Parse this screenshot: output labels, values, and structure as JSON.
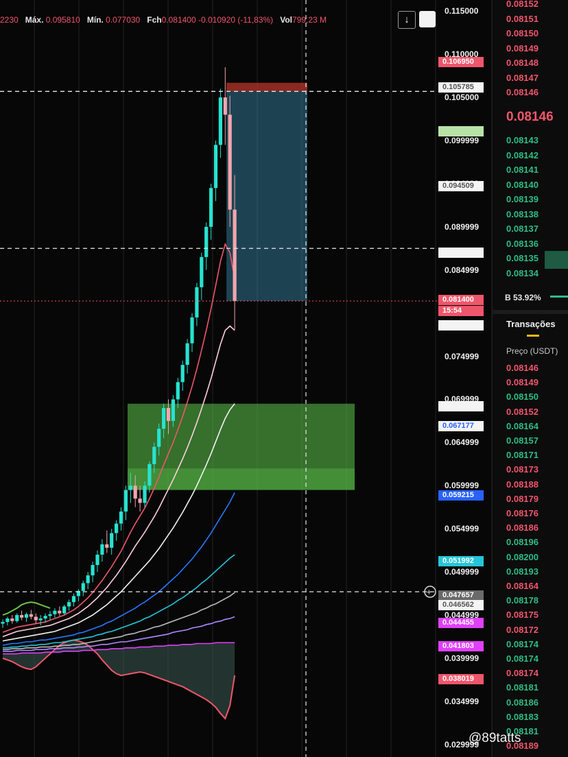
{
  "header": {
    "open_fragment": "2230",
    "high_label": "Máx.",
    "high_value": "0.095810",
    "low_label": "Mín.",
    "low_value": "0.077030",
    "close_label": "Fch",
    "close_value": "0.081400",
    "change": "-0.010920 (-11,83%)",
    "vol_label": "Vol",
    "vol_value": "799,23 M",
    "download_icon": "↓"
  },
  "price_axis": {
    "ticks": [
      "0.115000",
      "0.110000",
      "0.105000",
      "0.099999",
      "0.094999",
      "0.089999",
      "0.084999",
      "0.074999",
      "0.069999",
      "0.064999",
      "0.059999",
      "0.054999",
      "0.049999",
      "0.044999",
      "0.039999",
      "0.034999",
      "0.029999"
    ],
    "badges": [
      {
        "text": "0.106950",
        "bg": "#f0566b",
        "fg": "#ffffff"
      },
      {
        "text": "0.105785",
        "bg": "#f4f4f4",
        "fg": "#555555"
      },
      {
        "text": "",
        "bg": "#b8e3a7",
        "fg": "#222222"
      },
      {
        "text": "0.094509",
        "bg": "#f4f4f4",
        "fg": "#555555"
      },
      {
        "text": "",
        "bg": "#f4f4f4",
        "fg": "#333333"
      },
      {
        "text": "0.081400",
        "bg": "#f0566b",
        "fg": "#ffffff"
      },
      {
        "text": "15:54",
        "bg": "#f0566b",
        "fg": "#ffffff"
      },
      {
        "text": "",
        "bg": "#f4f4f4",
        "fg": "#333333"
      },
      {
        "text": "",
        "bg": "#f4f4f4",
        "fg": "#333333"
      },
      {
        "text": "0.067177",
        "bg": "#f4f4f4",
        "fg": "#2962ff"
      },
      {
        "text": "0.059215",
        "bg": "#2962ff",
        "fg": "#ffffff"
      },
      {
        "text": "0.051992",
        "bg": "#26c6da",
        "fg": "#ffffff"
      },
      {
        "text": "0.047657",
        "bg": "#6a6a6a",
        "fg": "#ffffff"
      },
      {
        "text": "0.046562",
        "bg": "#f4f4f4",
        "fg": "#555555"
      },
      {
        "text": "0.044455",
        "bg": "#e040fb",
        "fg": "#ffffff"
      },
      {
        "text": "0.041803",
        "bg": "#e040fb",
        "fg": "#ffffff"
      },
      {
        "text": "0.038019",
        "bg": "#f0566b",
        "fg": "#ffffff"
      }
    ]
  },
  "orderbook": {
    "asks": [
      "0.08152",
      "0.08151",
      "0.08150",
      "0.08149",
      "0.08148",
      "0.08147",
      "0.08146"
    ],
    "last_price": "0.08146",
    "bids": [
      "0.08143",
      "0.08142",
      "0.08141",
      "0.08140",
      "0.08139",
      "0.08138",
      "0.08137",
      "0.08136",
      "0.08135",
      "0.08134"
    ],
    "buy_ratio": "B 53.92%"
  },
  "trades": {
    "tab_label": "Transações",
    "price_header": "Preço (USDT)",
    "rows": [
      {
        "p": "0.08146",
        "side": "sell"
      },
      {
        "p": "0.08149",
        "side": "sell"
      },
      {
        "p": "0.08150",
        "side": "buy"
      },
      {
        "p": "0.08152",
        "side": "sell"
      },
      {
        "p": "0.08164",
        "side": "buy"
      },
      {
        "p": "0.08157",
        "side": "buy"
      },
      {
        "p": "0.08171",
        "side": "buy"
      },
      {
        "p": "0.08173",
        "side": "sell"
      },
      {
        "p": "0.08188",
        "side": "sell"
      },
      {
        "p": "0.08179",
        "side": "sell"
      },
      {
        "p": "0.08176",
        "side": "sell"
      },
      {
        "p": "0.08186",
        "side": "sell"
      },
      {
        "p": "0.08196",
        "side": "buy"
      },
      {
        "p": "0.08200",
        "side": "buy"
      },
      {
        "p": "0.08193",
        "side": "buy"
      },
      {
        "p": "0.08164",
        "side": "sell"
      },
      {
        "p": "0.08178",
        "side": "buy"
      },
      {
        "p": "0.08175",
        "side": "sell"
      },
      {
        "p": "0.08172",
        "side": "sell"
      },
      {
        "p": "0.08174",
        "side": "buy"
      },
      {
        "p": "0.08174",
        "side": "buy"
      },
      {
        "p": "0.08174",
        "side": "sell"
      },
      {
        "p": "0.08181",
        "side": "buy"
      },
      {
        "p": "0.08186",
        "side": "buy"
      },
      {
        "p": "0.08183",
        "side": "buy"
      },
      {
        "p": "0.08181",
        "side": "buy"
      },
      {
        "p": "0.08189",
        "side": "sell"
      }
    ]
  },
  "watermark": "@89tatts",
  "colors": {
    "up": "#26e3d0",
    "down": "#f2a5ae",
    "sell": "#f0566b",
    "buy": "#2fbd85",
    "zone": "#5cc64a",
    "position": "#3a8fb0"
  },
  "chart_data": {
    "type": "candlestick",
    "ylim": [
      0.0295,
      0.1155
    ],
    "current_price": 0.0814,
    "candles": [
      [
        0.044,
        0.0445,
        0.0435,
        0.0442
      ],
      [
        0.0442,
        0.0448,
        0.0438,
        0.0446
      ],
      [
        0.0446,
        0.045,
        0.044,
        0.0443
      ],
      [
        0.0443,
        0.0452,
        0.0441,
        0.045
      ],
      [
        0.045,
        0.0455,
        0.0444,
        0.0447
      ],
      [
        0.0447,
        0.0453,
        0.0442,
        0.0451
      ],
      [
        0.0451,
        0.0456,
        0.0445,
        0.0448
      ],
      [
        0.0448,
        0.0452,
        0.044,
        0.0444
      ],
      [
        0.0444,
        0.045,
        0.0438,
        0.0446
      ],
      [
        0.0446,
        0.0452,
        0.0441,
        0.0449
      ],
      [
        0.0449,
        0.0455,
        0.0444,
        0.0451
      ],
      [
        0.0451,
        0.0458,
        0.0447,
        0.0455
      ],
      [
        0.0455,
        0.046,
        0.0449,
        0.0452
      ],
      [
        0.0452,
        0.0462,
        0.045,
        0.046
      ],
      [
        0.046,
        0.0468,
        0.0455,
        0.0465
      ],
      [
        0.0465,
        0.0475,
        0.046,
        0.0472
      ],
      [
        0.0472,
        0.048,
        0.0466,
        0.0478
      ],
      [
        0.0478,
        0.049,
        0.0472,
        0.0487
      ],
      [
        0.0487,
        0.05,
        0.048,
        0.0496
      ],
      [
        0.0496,
        0.0512,
        0.0488,
        0.0508
      ],
      [
        0.0508,
        0.0525,
        0.05,
        0.052
      ],
      [
        0.052,
        0.0538,
        0.0512,
        0.0532
      ],
      [
        0.0532,
        0.0548,
        0.0522,
        0.0528
      ],
      [
        0.0528,
        0.055,
        0.052,
        0.0545
      ],
      [
        0.0545,
        0.056,
        0.0536,
        0.0556
      ],
      [
        0.0556,
        0.0575,
        0.0548,
        0.057
      ],
      [
        0.057,
        0.06,
        0.056,
        0.0595
      ],
      [
        0.0595,
        0.0615,
        0.058,
        0.06
      ],
      [
        0.06,
        0.0612,
        0.0575,
        0.0585
      ],
      [
        0.0585,
        0.06,
        0.057,
        0.058
      ],
      [
        0.058,
        0.0605,
        0.0575,
        0.06
      ],
      [
        0.06,
        0.0628,
        0.0592,
        0.0625
      ],
      [
        0.0625,
        0.065,
        0.0615,
        0.0645
      ],
      [
        0.0645,
        0.0672,
        0.0635,
        0.0666
      ],
      [
        0.0666,
        0.0695,
        0.0655,
        0.069
      ],
      [
        0.069,
        0.07,
        0.066,
        0.0675
      ],
      [
        0.0675,
        0.0705,
        0.0668,
        0.07
      ],
      [
        0.07,
        0.0725,
        0.069,
        0.072
      ],
      [
        0.072,
        0.0745,
        0.071,
        0.074
      ],
      [
        0.074,
        0.077,
        0.073,
        0.0765
      ],
      [
        0.0765,
        0.08,
        0.0755,
        0.0795
      ],
      [
        0.0795,
        0.0835,
        0.0785,
        0.083
      ],
      [
        0.083,
        0.087,
        0.0815,
        0.0865
      ],
      [
        0.0865,
        0.0905,
        0.085,
        0.09
      ],
      [
        0.09,
        0.095,
        0.0885,
        0.0945
      ],
      [
        0.0945,
        0.1,
        0.093,
        0.0995
      ],
      [
        0.0995,
        0.106,
        0.098,
        0.105
      ],
      [
        0.105,
        0.1085,
        0.0995,
        0.103
      ],
      [
        0.103,
        0.1052,
        0.09,
        0.092
      ],
      [
        0.092,
        0.096,
        0.078,
        0.0814
      ]
    ],
    "moving_averages": [
      {
        "color": "#f0566b",
        "values": [
          0.043,
          0.0432,
          0.0434,
          0.0436,
          0.0437,
          0.0438,
          0.0439,
          0.044,
          0.0441,
          0.0442,
          0.0444,
          0.0446,
          0.0448,
          0.045,
          0.0453,
          0.0456,
          0.046,
          0.0465,
          0.047,
          0.0476,
          0.0483,
          0.049,
          0.0498,
          0.0506,
          0.0515,
          0.0524,
          0.0535,
          0.0546,
          0.0556,
          0.0565,
          0.0574,
          0.0585,
          0.0597,
          0.061,
          0.0624,
          0.0637,
          0.065,
          0.0665,
          0.068,
          0.0697,
          0.0715,
          0.0735,
          0.0757,
          0.078,
          0.0805,
          0.0832,
          0.086,
          0.088,
          0.087,
          0.084
        ]
      },
      {
        "color": "#ffd0dc",
        "values": [
          0.0425,
          0.0427,
          0.0429,
          0.0431,
          0.0432,
          0.0433,
          0.0434,
          0.0435,
          0.0436,
          0.0437,
          0.0438,
          0.044,
          0.0442,
          0.0444,
          0.0446,
          0.0449,
          0.0452,
          0.0456,
          0.046,
          0.0465,
          0.047,
          0.0476,
          0.0482,
          0.0489,
          0.0496,
          0.0504,
          0.0512,
          0.0521,
          0.053,
          0.0538,
          0.0546,
          0.0555,
          0.0564,
          0.0574,
          0.0585,
          0.0596,
          0.0607,
          0.0619,
          0.0631,
          0.0644,
          0.0658,
          0.0673,
          0.0689,
          0.0706,
          0.0724,
          0.0744,
          0.0764,
          0.078,
          0.0785,
          0.078
        ]
      },
      {
        "color": "#f2f2f2",
        "values": [
          0.042,
          0.0421,
          0.0422,
          0.0423,
          0.0424,
          0.0425,
          0.0426,
          0.0427,
          0.0428,
          0.0429,
          0.043,
          0.0431,
          0.0433,
          0.0435,
          0.0437,
          0.0439,
          0.0441,
          0.0444,
          0.0447,
          0.045,
          0.0454,
          0.0458,
          0.0462,
          0.0467,
          0.0472,
          0.0477,
          0.0483,
          0.0489,
          0.0495,
          0.0501,
          0.0507,
          0.0513,
          0.052,
          0.0527,
          0.0535,
          0.0543,
          0.0551,
          0.056,
          0.0569,
          0.0579,
          0.0589,
          0.06,
          0.0612,
          0.0624,
          0.0637,
          0.0651,
          0.0665,
          0.0678,
          0.0688,
          0.0695
        ]
      },
      {
        "color": "#2979ff",
        "values": [
          0.0415,
          0.0416,
          0.0417,
          0.0417,
          0.0418,
          0.0419,
          0.0419,
          0.042,
          0.0421,
          0.0421,
          0.0422,
          0.0423,
          0.0424,
          0.0425,
          0.0426,
          0.0427,
          0.0429,
          0.043,
          0.0432,
          0.0434,
          0.0436,
          0.0438,
          0.0441,
          0.0443,
          0.0446,
          0.0449,
          0.0452,
          0.0455,
          0.0458,
          0.0462,
          0.0465,
          0.0469,
          0.0473,
          0.0477,
          0.0482,
          0.0487,
          0.0492,
          0.0497,
          0.0503,
          0.0509,
          0.0515,
          0.0522,
          0.0529,
          0.0537,
          0.0545,
          0.0554,
          0.0563,
          0.0572,
          0.0581,
          0.0592
        ]
      },
      {
        "color": "#26c6da",
        "values": [
          0.0412,
          0.0412,
          0.0413,
          0.0413,
          0.0414,
          0.0414,
          0.0415,
          0.0415,
          0.0416,
          0.0416,
          0.0417,
          0.0418,
          0.0418,
          0.0419,
          0.042,
          0.0421,
          0.0422,
          0.0423,
          0.0424,
          0.0425,
          0.0427,
          0.0428,
          0.043,
          0.0431,
          0.0433,
          0.0435,
          0.0437,
          0.0439,
          0.0441,
          0.0443,
          0.0446,
          0.0448,
          0.0451,
          0.0454,
          0.0457,
          0.046,
          0.0463,
          0.0467,
          0.047,
          0.0474,
          0.0478,
          0.0482,
          0.0487,
          0.0491,
          0.0496,
          0.0501,
          0.0506,
          0.0511,
          0.0516,
          0.052
        ]
      },
      {
        "color": "#bdbdbd",
        "values": [
          0.041,
          0.041,
          0.0411,
          0.0411,
          0.0411,
          0.0412,
          0.0412,
          0.0412,
          0.0413,
          0.0413,
          0.0413,
          0.0414,
          0.0414,
          0.0415,
          0.0415,
          0.0416,
          0.0416,
          0.0417,
          0.0418,
          0.0419,
          0.042,
          0.0421,
          0.0422,
          0.0423,
          0.0424,
          0.0425,
          0.0427,
          0.0428,
          0.0429,
          0.0431,
          0.0432,
          0.0434,
          0.0436,
          0.0437,
          0.0439,
          0.0441,
          0.0443,
          0.0445,
          0.0447,
          0.0449,
          0.0451,
          0.0453,
          0.0456,
          0.0458,
          0.0461,
          0.0463,
          0.0466,
          0.0469,
          0.0472,
          0.0476
        ]
      },
      {
        "color": "#b388ff",
        "values": [
          0.0408,
          0.0408,
          0.0408,
          0.0409,
          0.0409,
          0.0409,
          0.0409,
          0.041,
          0.041,
          0.041,
          0.0411,
          0.0411,
          0.0411,
          0.0412,
          0.0412,
          0.0412,
          0.0413,
          0.0413,
          0.0414,
          0.0414,
          0.0415,
          0.0416,
          0.0416,
          0.0417,
          0.0418,
          0.0419,
          0.0419,
          0.042,
          0.0421,
          0.0422,
          0.0423,
          0.0424,
          0.0425,
          0.0426,
          0.0427,
          0.0428,
          0.043,
          0.0431,
          0.0432,
          0.0433,
          0.0435,
          0.0436,
          0.0437,
          0.0439,
          0.044,
          0.0442,
          0.0443,
          0.0445,
          0.0446,
          0.0448
        ]
      },
      {
        "color": "#e040fb",
        "values": [
          0.0405,
          0.0405,
          0.0405,
          0.0405,
          0.0406,
          0.0406,
          0.0406,
          0.0406,
          0.0406,
          0.0407,
          0.0407,
          0.0407,
          0.0407,
          0.0408,
          0.0408,
          0.0408,
          0.0408,
          0.0409,
          0.0409,
          0.0409,
          0.041,
          0.041,
          0.041,
          0.0411,
          0.0411,
          0.0411,
          0.0412,
          0.0412,
          0.0412,
          0.0413,
          0.0413,
          0.0413,
          0.0414,
          0.0414,
          0.0414,
          0.0415,
          0.0415,
          0.0415,
          0.0416,
          0.0416,
          0.0416,
          0.0417,
          0.0417,
          0.0417,
          0.0417,
          0.0418,
          0.0418,
          0.0418,
          0.0418,
          0.0418
        ]
      }
    ],
    "lower_band": [
      0.04,
      0.0398,
      0.0396,
      0.0393,
      0.039,
      0.0388,
      0.0387,
      0.039,
      0.0395,
      0.04,
      0.0405,
      0.041,
      0.0415,
      0.0418,
      0.042,
      0.0421,
      0.042,
      0.0418,
      0.0415,
      0.041,
      0.0405,
      0.0398,
      0.0392,
      0.0386,
      0.0382,
      0.038,
      0.0381,
      0.0382,
      0.0383,
      0.0384,
      0.0383,
      0.0381,
      0.0379,
      0.0377,
      0.0375,
      0.0373,
      0.0371,
      0.0369,
      0.0367,
      0.0364,
      0.0361,
      0.0358,
      0.0355,
      0.0352,
      0.0348,
      0.0343,
      0.0336,
      0.033,
      0.0345,
      0.038
    ],
    "upper_band_start": [
      0.045,
      0.0452,
      0.0455,
      0.0458,
      0.0462,
      0.0464,
      0.0465,
      0.0464,
      0.0462,
      0.046,
      0.0458
    ],
    "green_zone": {
      "top": 0.0695,
      "bottom": 0.0595,
      "inner_top": 0.062,
      "inner_bottom": 0.062
    },
    "position_box": {
      "entry": 0.1057,
      "stop_top": 0.1067,
      "bottom_price": 0.0814
    },
    "horizontal_dashed_levels": [
      0.1057,
      0.0875,
      0.0477
    ],
    "vertical_dashed_x_fraction": 0.62
  }
}
